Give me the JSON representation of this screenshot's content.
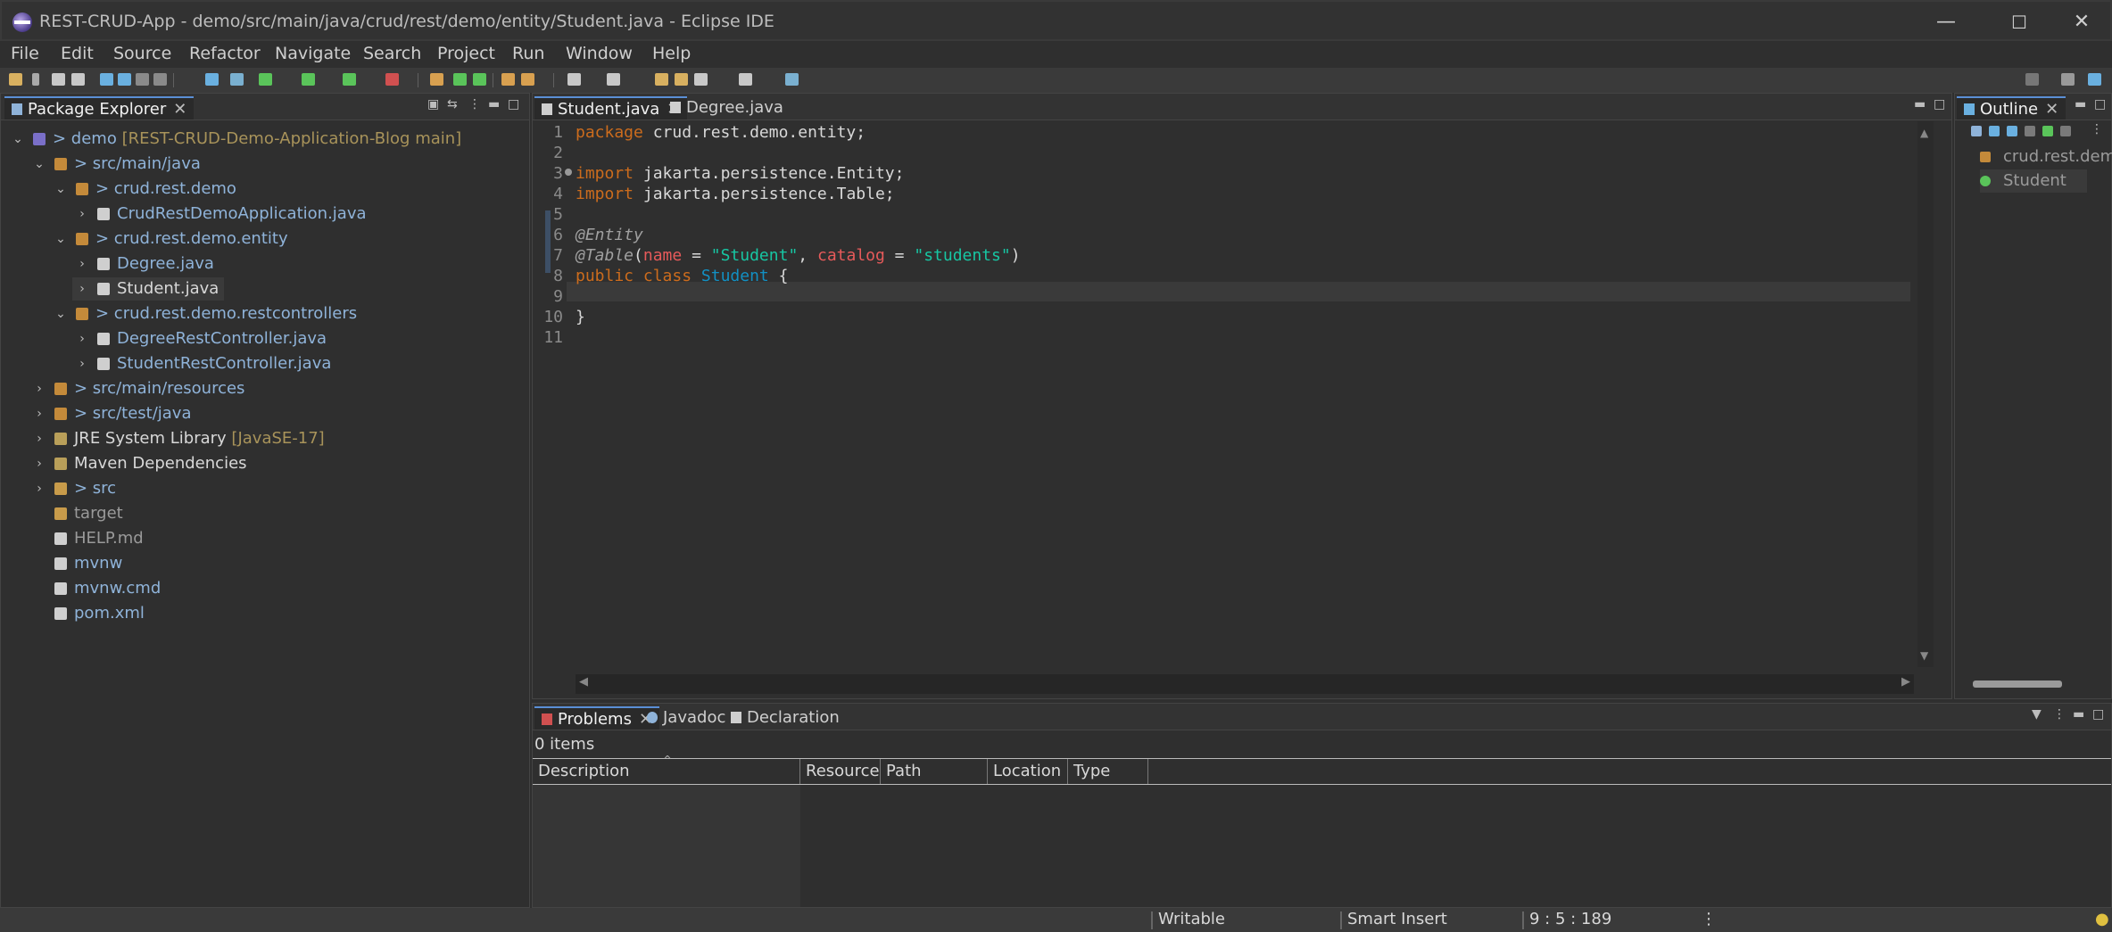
{
  "window": {
    "title": "REST-CRUD-App - demo/src/main/java/crud/rest/demo/entity/Student.java - Eclipse IDE",
    "minimize": "—",
    "maximize": "☐",
    "close": "✕"
  },
  "menu": [
    "File",
    "Edit",
    "Source",
    "Refactor",
    "Navigate",
    "Search",
    "Project",
    "Run",
    "Window",
    "Help"
  ],
  "package_explorer": {
    "tab": "Package Explorer",
    "tree": [
      {
        "depth": 0,
        "chev": "⌄",
        "icon": "prj",
        "pre": "> demo",
        "post": " [REST-CRUD-Demo-Application-Blog main]",
        "cls": "txt-blue"
      },
      {
        "depth": 1,
        "chev": "⌄",
        "icon": "pkg",
        "pre": "> src/main/java",
        "post": "",
        "cls": "txt-blue"
      },
      {
        "depth": 2,
        "chev": "⌄",
        "icon": "pkg",
        "pre": "> crud.rest.demo",
        "post": "",
        "cls": "txt-blue"
      },
      {
        "depth": 3,
        "chev": "›",
        "icon": "file",
        "pre": "CrudRestDemoApplication.java",
        "post": "",
        "cls": "txt-blue"
      },
      {
        "depth": 2,
        "chev": "⌄",
        "icon": "pkg",
        "pre": "> crud.rest.demo.entity",
        "post": "",
        "cls": "txt-blue"
      },
      {
        "depth": 3,
        "chev": "›",
        "icon": "file",
        "pre": "Degree.java",
        "post": "",
        "cls": "txt-blue"
      },
      {
        "depth": 3,
        "chev": "›",
        "icon": "file",
        "pre": "Student.java",
        "post": "",
        "cls": "txt-white"
      },
      {
        "depth": 2,
        "chev": "⌄",
        "icon": "pkg",
        "pre": "> crud.rest.demo.restcontrollers",
        "post": "",
        "cls": "txt-blue"
      },
      {
        "depth": 3,
        "chev": "›",
        "icon": "file",
        "pre": "DegreeRestController.java",
        "post": "",
        "cls": "txt-blue"
      },
      {
        "depth": 3,
        "chev": "›",
        "icon": "file",
        "pre": "StudentRestController.java",
        "post": "",
        "cls": "txt-blue"
      },
      {
        "depth": 1,
        "chev": "›",
        "icon": "pkg",
        "pre": "> src/main/resources",
        "post": "",
        "cls": "txt-blue"
      },
      {
        "depth": 1,
        "chev": "›",
        "icon": "pkg",
        "pre": "> src/test/java",
        "post": "",
        "cls": "txt-blue"
      },
      {
        "depth": 1,
        "chev": "›",
        "icon": "lib",
        "pre": "JRE System Library",
        "post": " [JavaSE-17]",
        "cls": "txt-white"
      },
      {
        "depth": 1,
        "chev": "›",
        "icon": "lib",
        "pre": "Maven Dependencies",
        "post": "",
        "cls": "txt-white"
      },
      {
        "depth": 1,
        "chev": "›",
        "icon": "folder",
        "pre": "> src",
        "post": "",
        "cls": "txt-blue"
      },
      {
        "depth": 1,
        "chev": "",
        "icon": "folder",
        "pre": "target",
        "post": "",
        "cls": "txt-gray"
      },
      {
        "depth": 1,
        "chev": "",
        "icon": "file",
        "pre": "HELP.md",
        "post": "",
        "cls": "txt-gray"
      },
      {
        "depth": 1,
        "chev": "",
        "icon": "file",
        "pre": "mvnw",
        "post": "",
        "cls": "txt-blue"
      },
      {
        "depth": 1,
        "chev": "",
        "icon": "file",
        "pre": "mvnw.cmd",
        "post": "",
        "cls": "txt-blue"
      },
      {
        "depth": 1,
        "chev": "",
        "icon": "file",
        "pre": "pom.xml",
        "post": "",
        "cls": "txt-blue"
      }
    ]
  },
  "editor": {
    "tabs": [
      {
        "label": "Student.java",
        "active": true,
        "close": "✕"
      },
      {
        "label": "Degree.java",
        "active": false,
        "close": ""
      }
    ],
    "lines": [
      [
        {
          "t": "package",
          "c": "kw"
        },
        {
          "t": " crud.rest.demo.entity;",
          "c": ""
        }
      ],
      [],
      [
        {
          "t": "import",
          "c": "kw"
        },
        {
          "t": " jakarta.persistence.Entity;",
          "c": ""
        }
      ],
      [
        {
          "t": "import",
          "c": "kw"
        },
        {
          "t": " jakarta.persistence.Table;",
          "c": ""
        }
      ],
      [],
      [
        {
          "t": "@Entity",
          "c": "ann"
        }
      ],
      [
        {
          "t": "@Table",
          "c": "ann"
        },
        {
          "t": "(",
          "c": ""
        },
        {
          "t": "name",
          "c": "attr"
        },
        {
          "t": " = ",
          "c": ""
        },
        {
          "t": "\"Student\"",
          "c": "str"
        },
        {
          "t": ", ",
          "c": ""
        },
        {
          "t": "catalog",
          "c": "attr"
        },
        {
          "t": " = ",
          "c": ""
        },
        {
          "t": "\"students\"",
          "c": "str"
        },
        {
          "t": ")",
          "c": ""
        }
      ],
      [
        {
          "t": "public",
          "c": "kw"
        },
        {
          "t": " ",
          "c": ""
        },
        {
          "t": "class",
          "c": "kw"
        },
        {
          "t": " ",
          "c": ""
        },
        {
          "t": "Student",
          "c": "cls"
        },
        {
          "t": " {",
          "c": ""
        }
      ],
      [],
      [
        {
          "t": "}",
          "c": ""
        }
      ],
      []
    ]
  },
  "outline": {
    "tab": "Outline",
    "items": [
      "crud.rest.demo.entity",
      "Student"
    ]
  },
  "problems": {
    "tabs": [
      "Problems",
      "Javadoc",
      "Declaration"
    ],
    "count": "0 items",
    "columns": [
      "Description",
      "Resource",
      "Path",
      "Location",
      "Type"
    ]
  },
  "status": {
    "writable": "Writable",
    "insert_mode": "Smart Insert",
    "position": "9 : 5 : 189"
  }
}
